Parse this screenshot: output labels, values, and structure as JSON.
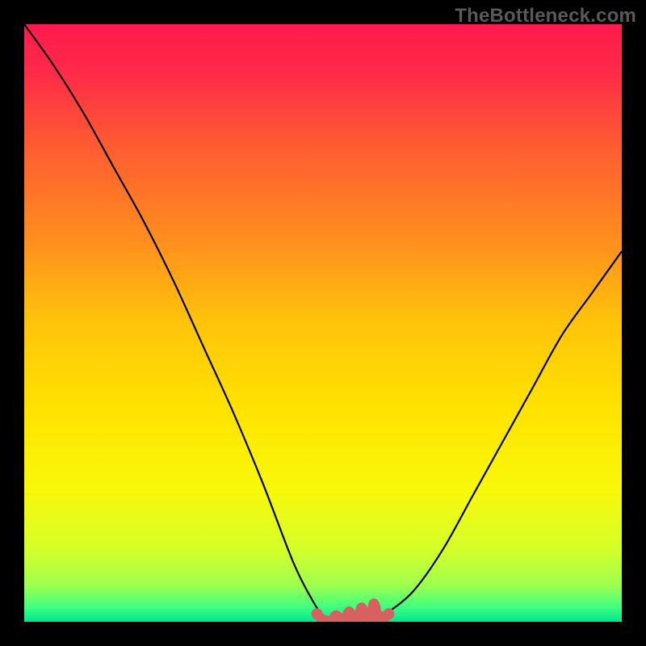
{
  "watermark": "TheBottleneck.com",
  "chart_data": {
    "type": "line",
    "title": "",
    "xlabel": "",
    "ylabel": "",
    "xlim": [
      0,
      100
    ],
    "ylim": [
      0,
      100
    ],
    "x": [
      0,
      5,
      10,
      15,
      20,
      25,
      30,
      35,
      40,
      45,
      48,
      50,
      52,
      55,
      58,
      60,
      65,
      70,
      75,
      80,
      85,
      90,
      95,
      100
    ],
    "values": [
      100,
      93,
      85,
      76,
      67,
      57,
      46,
      35,
      23,
      10,
      4,
      1,
      0,
      0,
      0,
      1,
      5,
      12,
      21,
      30,
      39,
      48,
      55,
      62
    ],
    "flat_zone": {
      "x_start": 49,
      "x_end": 61,
      "y": 0.5
    },
    "gradient_stops": [
      {
        "offset": 0.0,
        "color": "#ff1a4e"
      },
      {
        "offset": 0.08,
        "color": "#ff2a48"
      },
      {
        "offset": 0.2,
        "color": "#ff5a32"
      },
      {
        "offset": 0.35,
        "color": "#ff8a1f"
      },
      {
        "offset": 0.5,
        "color": "#ffc40a"
      },
      {
        "offset": 0.65,
        "color": "#ffe400"
      },
      {
        "offset": 0.78,
        "color": "#f8f80a"
      },
      {
        "offset": 0.88,
        "color": "#d4ff2a"
      },
      {
        "offset": 0.94,
        "color": "#9cff4e"
      },
      {
        "offset": 0.975,
        "color": "#40ff80"
      },
      {
        "offset": 1.0,
        "color": "#00e690"
      }
    ],
    "flat_zone_color": "#d86060",
    "curve_color": "#000000"
  }
}
